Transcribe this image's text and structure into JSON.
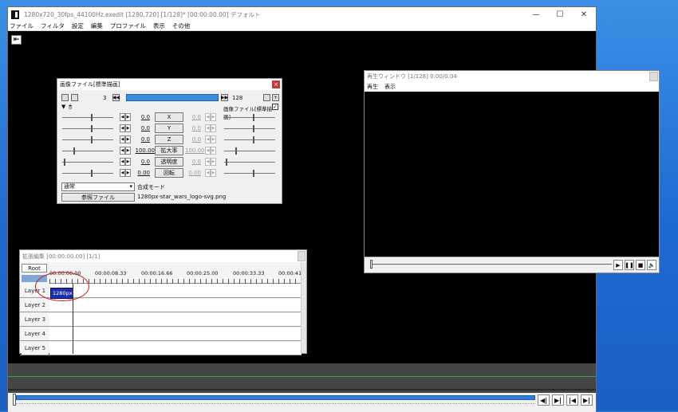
{
  "main_window": {
    "title": "1280x720_30fps_44100Hz.exedit [1280,720]  [1/128]*  [00:00:00.00]  デフォルト",
    "controls": {
      "minimize": "—",
      "maximize": "☐",
      "close": "✕"
    },
    "menu": [
      "ファイル",
      "フィルタ",
      "設定",
      "編集",
      "プロファイル",
      "表示",
      "その他"
    ],
    "back_glyph": "⇤",
    "nav_buttons": [
      "◀|",
      "▶|",
      "|◀",
      "▶|"
    ]
  },
  "object_dialog": {
    "title": "画像ファイル[標準描画]",
    "close": "×",
    "frame_start": "3",
    "frame_end": "128",
    "object_label": "画像ファイル[標準描画]",
    "properties": [
      {
        "value": "0.0",
        "label": "X",
        "value_right": "0.0"
      },
      {
        "value": "0.0",
        "label": "Y",
        "value_right": "0.0"
      },
      {
        "value": "0.0",
        "label": "Z",
        "value_right": "0.0"
      },
      {
        "value": "100.00",
        "label": "拡大率",
        "value_right": "100.00"
      },
      {
        "value": "0.0",
        "label": "透明度",
        "value_right": "0.0"
      },
      {
        "value": "0.00",
        "label": "回転",
        "value_right": "0.00"
      }
    ],
    "blend_select": "通常",
    "blend_label": "合成モード",
    "ref_button": "参照ファイル",
    "ref_file": "1280px-star_wars_logo-svg.png"
  },
  "preview": {
    "title": "再生ウィンドウ  [1/128]  0:00/0:04",
    "menu": [
      "再生",
      "表示"
    ],
    "buttons": [
      "▶",
      "❚❚",
      "■",
      "🔈"
    ]
  },
  "timeline": {
    "title": "拡張編集 [00:00:00.00] [1/1]",
    "root": "Root",
    "ruler": [
      "00:00:00.00",
      "00:00:08.33",
      "00:00:16.66",
      "00:00:25.00",
      "00:00:33.33",
      "00:00:41"
    ],
    "layers": [
      "Layer 1",
      "Layer 2",
      "Layer 3",
      "Layer 4",
      "Layer 5"
    ],
    "clip_label": "1280px-"
  },
  "colors": {
    "accent": "#2d7fd6",
    "clip": "#1f2fa8",
    "highlight_ring": "#d01b1b"
  }
}
